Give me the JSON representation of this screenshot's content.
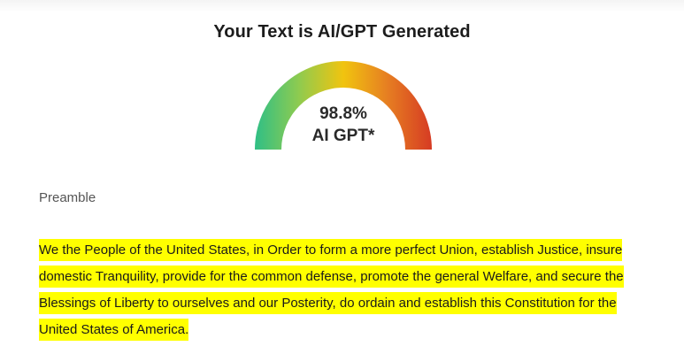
{
  "result": {
    "title": "Your Text is AI/GPT Generated"
  },
  "gauge": {
    "value_text": "98.8%",
    "label": "AI GPT*",
    "percent": 98.8,
    "colors": [
      "#2fbf86",
      "#8fcb4f",
      "#f1c40f",
      "#e67e22",
      "#d63b23"
    ]
  },
  "document": {
    "heading": "Preamble",
    "body": "We the People of the United States, in Order to form a more perfect Union, establish Justice, insure domestic Tranquility, provide for the common defense, promote the general Welfare, and secure the Blessings of Liberty to ourselves and our Posterity, do ordain and establish this Constitution for the United States of America.",
    "highlight_color": "#ffff00"
  }
}
